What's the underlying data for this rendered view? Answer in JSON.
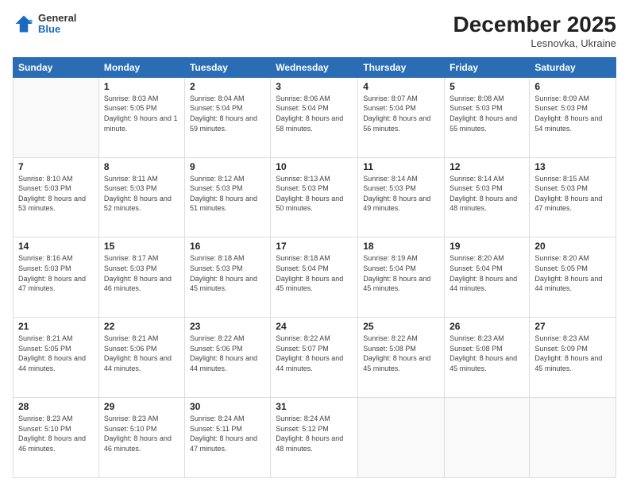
{
  "header": {
    "logo": {
      "general": "General",
      "blue": "Blue"
    },
    "title": "December 2025",
    "subtitle": "Lesnovka, Ukraine"
  },
  "calendar": {
    "weekdays": [
      "Sunday",
      "Monday",
      "Tuesday",
      "Wednesday",
      "Thursday",
      "Friday",
      "Saturday"
    ],
    "weeks": [
      [
        {
          "day": "",
          "sunrise": "",
          "sunset": "",
          "daylight": ""
        },
        {
          "day": "1",
          "sunrise": "Sunrise: 8:03 AM",
          "sunset": "Sunset: 5:05 PM",
          "daylight": "Daylight: 9 hours and 1 minute."
        },
        {
          "day": "2",
          "sunrise": "Sunrise: 8:04 AM",
          "sunset": "Sunset: 5:04 PM",
          "daylight": "Daylight: 8 hours and 59 minutes."
        },
        {
          "day": "3",
          "sunrise": "Sunrise: 8:06 AM",
          "sunset": "Sunset: 5:04 PM",
          "daylight": "Daylight: 8 hours and 58 minutes."
        },
        {
          "day": "4",
          "sunrise": "Sunrise: 8:07 AM",
          "sunset": "Sunset: 5:04 PM",
          "daylight": "Daylight: 8 hours and 56 minutes."
        },
        {
          "day": "5",
          "sunrise": "Sunrise: 8:08 AM",
          "sunset": "Sunset: 5:03 PM",
          "daylight": "Daylight: 8 hours and 55 minutes."
        },
        {
          "day": "6",
          "sunrise": "Sunrise: 8:09 AM",
          "sunset": "Sunset: 5:03 PM",
          "daylight": "Daylight: 8 hours and 54 minutes."
        }
      ],
      [
        {
          "day": "7",
          "sunrise": "Sunrise: 8:10 AM",
          "sunset": "Sunset: 5:03 PM",
          "daylight": "Daylight: 8 hours and 53 minutes."
        },
        {
          "day": "8",
          "sunrise": "Sunrise: 8:11 AM",
          "sunset": "Sunset: 5:03 PM",
          "daylight": "Daylight: 8 hours and 52 minutes."
        },
        {
          "day": "9",
          "sunrise": "Sunrise: 8:12 AM",
          "sunset": "Sunset: 5:03 PM",
          "daylight": "Daylight: 8 hours and 51 minutes."
        },
        {
          "day": "10",
          "sunrise": "Sunrise: 8:13 AM",
          "sunset": "Sunset: 5:03 PM",
          "daylight": "Daylight: 8 hours and 50 minutes."
        },
        {
          "day": "11",
          "sunrise": "Sunrise: 8:14 AM",
          "sunset": "Sunset: 5:03 PM",
          "daylight": "Daylight: 8 hours and 49 minutes."
        },
        {
          "day": "12",
          "sunrise": "Sunrise: 8:14 AM",
          "sunset": "Sunset: 5:03 PM",
          "daylight": "Daylight: 8 hours and 48 minutes."
        },
        {
          "day": "13",
          "sunrise": "Sunrise: 8:15 AM",
          "sunset": "Sunset: 5:03 PM",
          "daylight": "Daylight: 8 hours and 47 minutes."
        }
      ],
      [
        {
          "day": "14",
          "sunrise": "Sunrise: 8:16 AM",
          "sunset": "Sunset: 5:03 PM",
          "daylight": "Daylight: 8 hours and 47 minutes."
        },
        {
          "day": "15",
          "sunrise": "Sunrise: 8:17 AM",
          "sunset": "Sunset: 5:03 PM",
          "daylight": "Daylight: 8 hours and 46 minutes."
        },
        {
          "day": "16",
          "sunrise": "Sunrise: 8:18 AM",
          "sunset": "Sunset: 5:03 PM",
          "daylight": "Daylight: 8 hours and 45 minutes."
        },
        {
          "day": "17",
          "sunrise": "Sunrise: 8:18 AM",
          "sunset": "Sunset: 5:04 PM",
          "daylight": "Daylight: 8 hours and 45 minutes."
        },
        {
          "day": "18",
          "sunrise": "Sunrise: 8:19 AM",
          "sunset": "Sunset: 5:04 PM",
          "daylight": "Daylight: 8 hours and 45 minutes."
        },
        {
          "day": "19",
          "sunrise": "Sunrise: 8:20 AM",
          "sunset": "Sunset: 5:04 PM",
          "daylight": "Daylight: 8 hours and 44 minutes."
        },
        {
          "day": "20",
          "sunrise": "Sunrise: 8:20 AM",
          "sunset": "Sunset: 5:05 PM",
          "daylight": "Daylight: 8 hours and 44 minutes."
        }
      ],
      [
        {
          "day": "21",
          "sunrise": "Sunrise: 8:21 AM",
          "sunset": "Sunset: 5:05 PM",
          "daylight": "Daylight: 8 hours and 44 minutes."
        },
        {
          "day": "22",
          "sunrise": "Sunrise: 8:21 AM",
          "sunset": "Sunset: 5:06 PM",
          "daylight": "Daylight: 8 hours and 44 minutes."
        },
        {
          "day": "23",
          "sunrise": "Sunrise: 8:22 AM",
          "sunset": "Sunset: 5:06 PM",
          "daylight": "Daylight: 8 hours and 44 minutes."
        },
        {
          "day": "24",
          "sunrise": "Sunrise: 8:22 AM",
          "sunset": "Sunset: 5:07 PM",
          "daylight": "Daylight: 8 hours and 44 minutes."
        },
        {
          "day": "25",
          "sunrise": "Sunrise: 8:22 AM",
          "sunset": "Sunset: 5:08 PM",
          "daylight": "Daylight: 8 hours and 45 minutes."
        },
        {
          "day": "26",
          "sunrise": "Sunrise: 8:23 AM",
          "sunset": "Sunset: 5:08 PM",
          "daylight": "Daylight: 8 hours and 45 minutes."
        },
        {
          "day": "27",
          "sunrise": "Sunrise: 8:23 AM",
          "sunset": "Sunset: 5:09 PM",
          "daylight": "Daylight: 8 hours and 45 minutes."
        }
      ],
      [
        {
          "day": "28",
          "sunrise": "Sunrise: 8:23 AM",
          "sunset": "Sunset: 5:10 PM",
          "daylight": "Daylight: 8 hours and 46 minutes."
        },
        {
          "day": "29",
          "sunrise": "Sunrise: 8:23 AM",
          "sunset": "Sunset: 5:10 PM",
          "daylight": "Daylight: 8 hours and 46 minutes."
        },
        {
          "day": "30",
          "sunrise": "Sunrise: 8:24 AM",
          "sunset": "Sunset: 5:11 PM",
          "daylight": "Daylight: 8 hours and 47 minutes."
        },
        {
          "day": "31",
          "sunrise": "Sunrise: 8:24 AM",
          "sunset": "Sunset: 5:12 PM",
          "daylight": "Daylight: 8 hours and 48 minutes."
        },
        {
          "day": "",
          "sunrise": "",
          "sunset": "",
          "daylight": ""
        },
        {
          "day": "",
          "sunrise": "",
          "sunset": "",
          "daylight": ""
        },
        {
          "day": "",
          "sunrise": "",
          "sunset": "",
          "daylight": ""
        }
      ]
    ]
  }
}
